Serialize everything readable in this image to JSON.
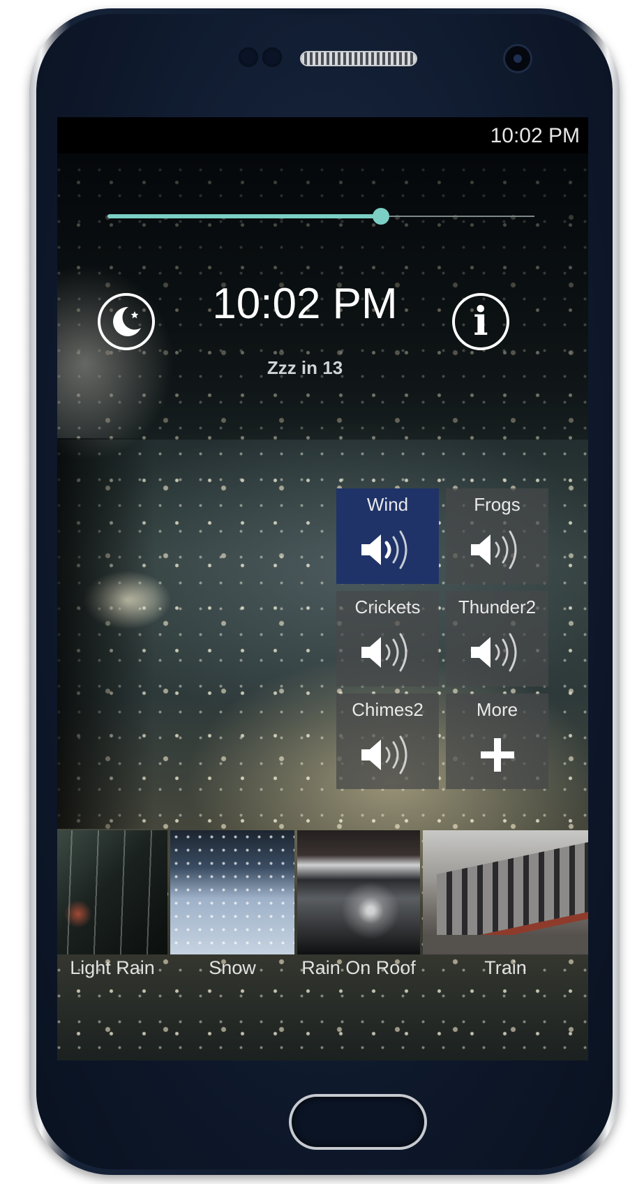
{
  "status_bar": {
    "time": "10:02 PM"
  },
  "volume_slider": {
    "value": 0.64
  },
  "header": {
    "clock": "10:02 PM",
    "countdown": "Zzz in 13"
  },
  "sound_grid": {
    "tiles": [
      {
        "label": "Wind",
        "active": true
      },
      {
        "label": "Frogs",
        "active": false
      },
      {
        "label": "Crickets",
        "active": false
      },
      {
        "label": "Thunder2",
        "active": false
      },
      {
        "label": "Chimes2",
        "active": false
      },
      {
        "label": "More",
        "active": false
      }
    ]
  },
  "scenes": [
    {
      "label": "Light Rain"
    },
    {
      "label": "Snow"
    },
    {
      "label": "Rain On Roof"
    },
    {
      "label": "Train"
    }
  ],
  "colors": {
    "accent": "#7ccfc4",
    "active_tile": "#1f3368"
  },
  "icons": {
    "sleep": "moon-icon",
    "info": "info-icon",
    "sound": "speaker-icon",
    "more": "plus-icon"
  }
}
